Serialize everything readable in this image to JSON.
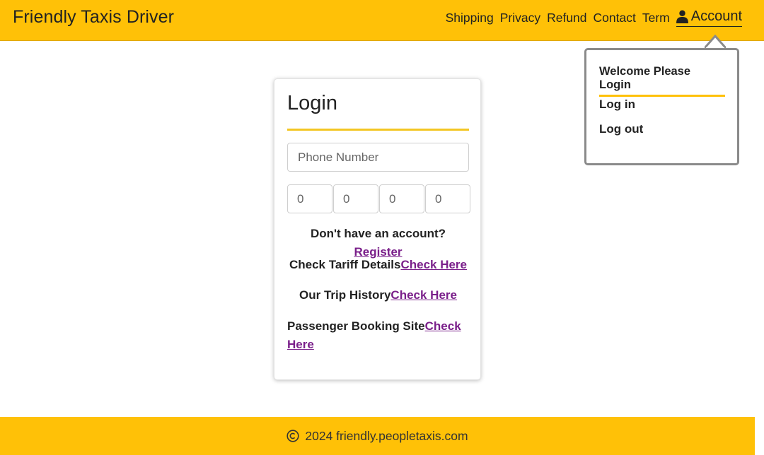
{
  "header": {
    "brand": "Friendly Taxis Driver",
    "nav": [
      "Shipping",
      "Privacy",
      "Refund",
      "Contact",
      "Term"
    ],
    "account_label": "Account"
  },
  "dropdown": {
    "title": "Welcome Please Login",
    "items": [
      "Log in",
      "Log out"
    ]
  },
  "login": {
    "title": "Login",
    "phone_placeholder": "Phone Number",
    "otp_placeholders": [
      "0",
      "0",
      "0",
      "0"
    ],
    "register_prompt": "Don't have an account?",
    "register_link": "Register",
    "tariff_prompt": "Check Tariff Details",
    "tariff_link": "Check Here",
    "trip_prompt": "Our Trip History",
    "trip_link": "Check Here",
    "booking_prompt": "Passenger Booking Site",
    "booking_link": "Check Here"
  },
  "footer": {
    "text": "2024 friendly.peopletaxis.com"
  },
  "colors": {
    "primary": "#ffc107",
    "link": "#7a1f8a",
    "text": "#222222"
  }
}
